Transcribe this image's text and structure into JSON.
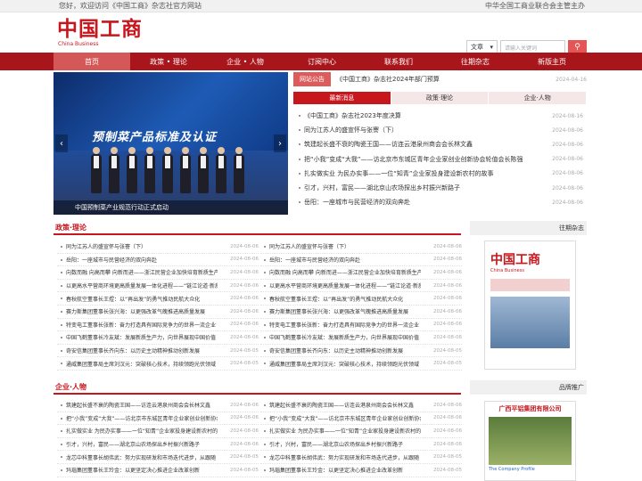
{
  "topbar": {
    "welcome": "您好，欢迎访问《中国工商》杂志社官方网站",
    "sponsor": "中华全国工商业联合会主管主办"
  },
  "logo": {
    "main": "中国工商",
    "sub": "China Business"
  },
  "search": {
    "select_label": "文章",
    "select_icon": "chevron-down-icon",
    "placeholder": "请输入关键词",
    "icon": "search-icon"
  },
  "nav": [
    "首页",
    "政策 • 理论",
    "企业 • 人物",
    "订阅中心",
    "联系我们",
    "往期杂志",
    "新版主页"
  ],
  "slider": {
    "screen_title": "预制菜产品标准及认证",
    "caption": "中国预制菜产业规范行动正式启动"
  },
  "notice": {
    "label": "网站公告",
    "text": "《中国工商》杂志社2024年部门预算",
    "date": "2024-04-16"
  },
  "tabs": [
    "最新消息",
    "政策·理论",
    "企业·人物"
  ],
  "latest": [
    {
      "t": "《中国工商》杂志社2023年度决算",
      "d": "2024-08-16"
    },
    {
      "t": "同为江苏人的盛宣怀与张謇（下）",
      "d": "2024-08-06"
    },
    {
      "t": "筑建起长盛不衰的陶瓷王国——访连云港泉州商会会长林文鑫",
      "d": "2024-08-06"
    },
    {
      "t": "把“小我”变成“大我”——访北京市东城区青年企业家创业创新协会轮值会长陈强",
      "d": "2024-08-06"
    },
    {
      "t": "扎实做实业 为民办实事——一位“知青”企业家投身建设新农村的故事",
      "d": "2024-08-06"
    },
    {
      "t": "引才，兴村，富民——湖北京山农场探出乡村振兴新路子",
      "d": "2024-08-06"
    },
    {
      "t": "岳阳：一座城市与民营经济的双向奔赴",
      "d": "2024-08-06"
    }
  ],
  "policy": {
    "title": "政策·理论",
    "rows": [
      {
        "t": "同为江苏人的盛宣怀与张謇（下）",
        "d": "2024-08-06"
      },
      {
        "t": "岳阳：一座城市与民营经济的双向奔赴",
        "d": "2024-08-06"
      },
      {
        "t": "向数而融 向高而攀 向新而进——浙江民营企业加快培育新质生产力",
        "d": "2024-08-06"
      },
      {
        "t": "以更高水平营商环境更高质量发展一体化进程——“链江论道·新质生产力”",
        "d": "2024-08-06"
      },
      {
        "t": "春秋航空董事长王煜：以“再出发”的勇气推动民航大众化",
        "d": "2024-08-06"
      },
      {
        "t": "赛力斯集团董事长张兴海：以更强改革气魄推进高质量发展",
        "d": "2024-08-06"
      },
      {
        "t": "特变电工董事长张新：奋力打造具有国际竞争力的世界一流企业",
        "d": "2024-08-06"
      },
      {
        "t": "中国飞鹤董事长冷友斌：发展新质生产力，向世界展现中国价值",
        "d": "2024-08-06"
      },
      {
        "t": "奇安信集团董事长齐向东：以历史主动精神推动创新发展",
        "d": "2024-08-05"
      },
      {
        "t": "通威集团董事局主席刘汉元：突破核心技术，持续领跑光伏领域",
        "d": "2024-08-05"
      }
    ]
  },
  "company": {
    "title": "企业·人物",
    "rows": [
      {
        "t": "筑建起长盛不衰的陶瓷王国——访连云港泉州商会会长林文鑫",
        "d": "2024-08-06"
      },
      {
        "t": "把“小我”变成“大我”——访北京市东城区青年企业家创业创新协会",
        "d": "2024-08-06"
      },
      {
        "t": "扎实做实业 为民办实事——一位“知青”企业家投身建设新农村的故事",
        "d": "2024-08-06"
      },
      {
        "t": "引才，兴村，富民——湖北京山农场探出乡村振兴新路子",
        "d": "2024-08-06"
      },
      {
        "t": "龙芯中科董事长胡伟武：努力实现研发和市场迭代进步，从跟随",
        "d": "2024-08-05"
      },
      {
        "t": "玛瑙集团董事长王玲金：以更坚定决心推进企业改革创新",
        "d": "2024-08-05"
      }
    ]
  },
  "sidebar": {
    "magazine_head": "往期杂志",
    "magazine_title": "中国工商",
    "magazine_sub": "China Business",
    "brand_head": "品牌推广",
    "brand_title": "广西平铝集团有限公司",
    "brand_foot": "The Company Profile"
  },
  "colors": {
    "brand": "#c8161d",
    "nav_bg": "#a8151b"
  }
}
